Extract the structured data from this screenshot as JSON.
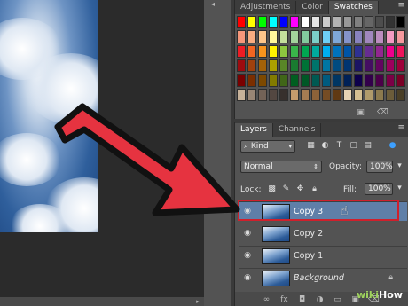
{
  "top_panel": {
    "tabs": [
      {
        "label": "Adjustments",
        "active": false
      },
      {
        "label": "Color",
        "active": false
      },
      {
        "label": "Swatches",
        "active": true
      }
    ],
    "menu_icon": "panel-menu-icon",
    "swatches": [
      "#ff0000",
      "#ffff00",
      "#00ff00",
      "#00ffff",
      "#0000ff",
      "#ff00ff",
      "#ffffff",
      "#e6e6e6",
      "#cccccc",
      "#b3b3b3",
      "#999999",
      "#808080",
      "#666666",
      "#4d4d4d",
      "#333333",
      "#000000",
      "#f7977a",
      "#f9ad81",
      "#fdc68a",
      "#fff79a",
      "#c4df9b",
      "#a3d39c",
      "#82ca9d",
      "#7bcdc8",
      "#6ecff6",
      "#7ea7d8",
      "#8493ca",
      "#8882be",
      "#a187be",
      "#bc8dbf",
      "#f49ac2",
      "#f6989d",
      "#ed1c24",
      "#f26522",
      "#f7941d",
      "#fff200",
      "#8dc73f",
      "#39b54a",
      "#00a651",
      "#00a99d",
      "#00aeef",
      "#0072bc",
      "#0054a6",
      "#2e3192",
      "#662d91",
      "#92278f",
      "#ec008c",
      "#ed145b",
      "#9e0b0f",
      "#a0410d",
      "#a36209",
      "#aba000",
      "#598527",
      "#1a7b30",
      "#007236",
      "#00746b",
      "#0076a3",
      "#004b80",
      "#003471",
      "#1b1464",
      "#440e62",
      "#630460",
      "#9e005d",
      "#9e0039",
      "#790000",
      "#7b2e00",
      "#7d4900",
      "#827b00",
      "#406618",
      "#005e20",
      "#005826",
      "#005952",
      "#005b7f",
      "#003663",
      "#002157",
      "#0d004c",
      "#32004b",
      "#4b0049",
      "#7b0046",
      "#7a0026",
      "#c7b299",
      "#998675",
      "#736357",
      "#534741",
      "#37302d",
      "#c69c6d",
      "#a67c52",
      "#8c6239",
      "#754c24",
      "#603913",
      "#e6d3b3",
      "#d4bf92",
      "#b09b6b",
      "#8c7a4e",
      "#6b5c3a",
      "#4a3f27"
    ]
  },
  "layers_panel": {
    "tabs": [
      {
        "label": "Layers",
        "active": true
      },
      {
        "label": "Channels",
        "active": false
      }
    ],
    "filter": {
      "label": "Kind"
    },
    "blend_mode": "Normal",
    "opacity_label": "Opacity:",
    "opacity_value": "100%",
    "lock_label": "Lock:",
    "fill_label": "Fill:",
    "fill_value": "100%",
    "layers": [
      {
        "name": "Copy 3",
        "selected": true,
        "visible": true,
        "locked": false
      },
      {
        "name": "Copy 2",
        "selected": false,
        "visible": true,
        "locked": false
      },
      {
        "name": "Copy 1",
        "selected": false,
        "visible": true,
        "locked": false
      },
      {
        "name": "Background",
        "selected": false,
        "visible": true,
        "locked": true
      }
    ],
    "footer_icons": [
      "link-icon",
      "fx-icon",
      "mask-icon",
      "adjustment-icon",
      "folder-icon",
      "new-layer-icon",
      "trash-icon"
    ]
  },
  "annotation": {
    "arrow_color": "#e63340",
    "outline_color": "#d0202c"
  },
  "watermark": {
    "prefix": "wiki",
    "suffix": "How"
  }
}
